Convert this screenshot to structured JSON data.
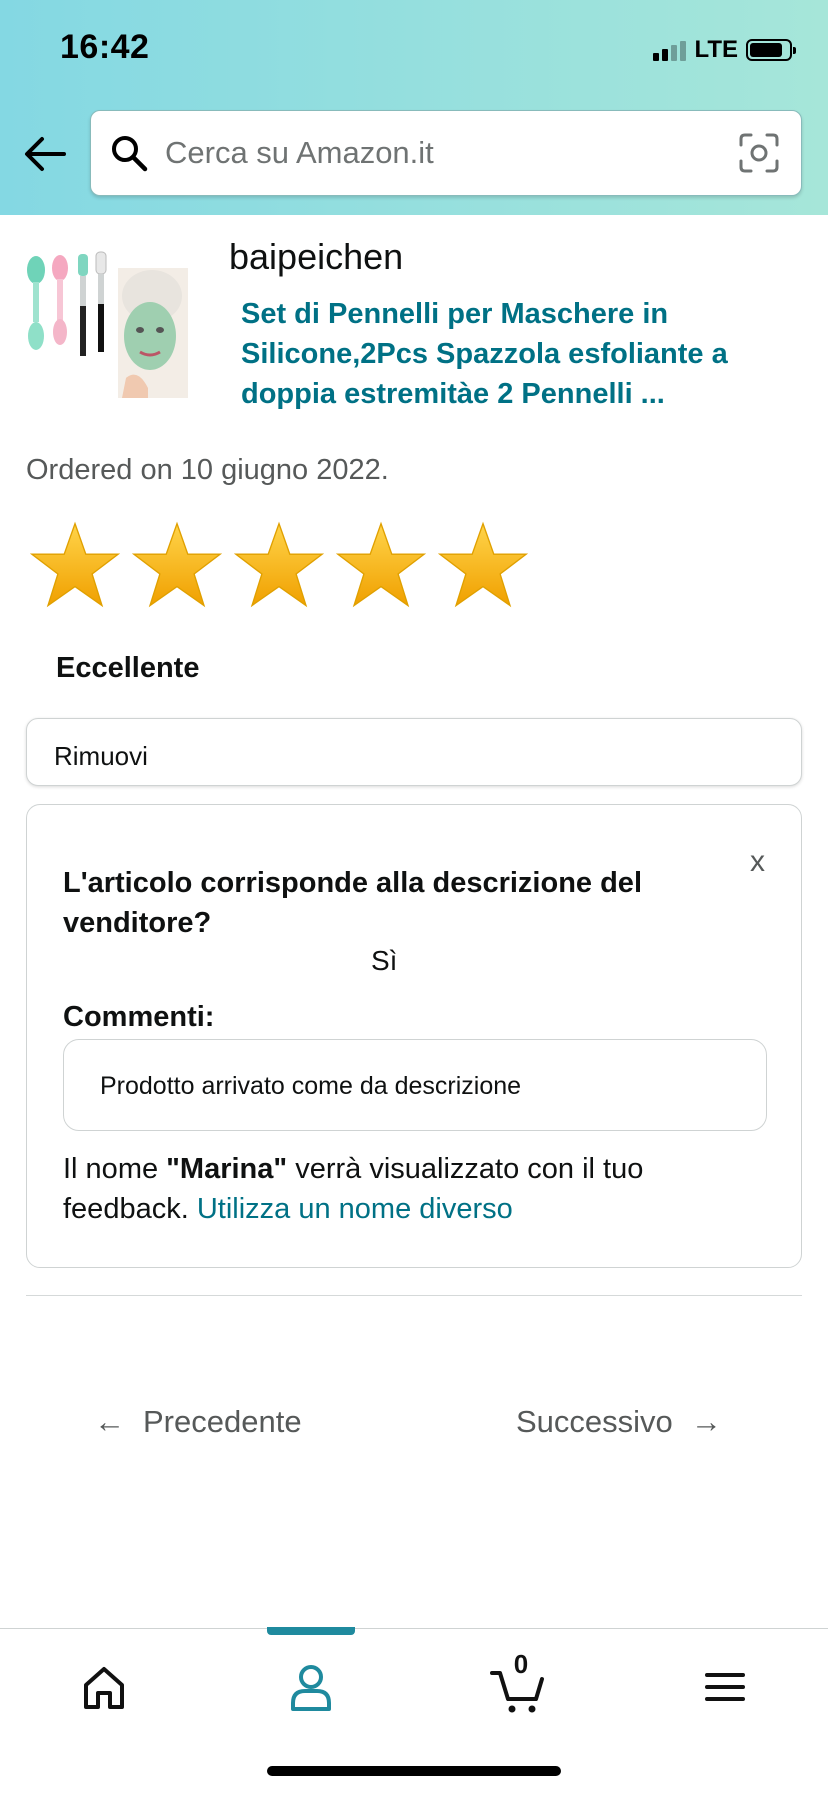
{
  "status_bar": {
    "time": "16:42",
    "network": "LTE"
  },
  "search": {
    "placeholder": "Cerca su Amazon.it"
  },
  "product": {
    "brand": "baipeichen",
    "title": "Set di Pennelli per Maschere in Silicone,2Pcs Spazzola esfoliante a doppia estremitàe 2 Pennelli ...",
    "ordered_text": "Ordered on 10 giugno 2022."
  },
  "rating": {
    "stars": 5,
    "max": 5,
    "label": "Eccellente"
  },
  "remove_label": "Rimuovi",
  "feedback": {
    "close_label": "x",
    "question": "L'articolo corrisponde alla descrizione del venditore?",
    "answer": "Sì",
    "comments_label": "Commenti:",
    "comment_value": "Prodotto arrivato come da descrizione",
    "name_prefix": "Il nome ",
    "name": "\"Marina\"",
    "name_suffix": " verrà visualizzato con il tuo feedback. ",
    "name_link": "Utilizza un nome diverso"
  },
  "pagination": {
    "prev_arrow": "←",
    "prev_label": "Precedente",
    "next_label": "Successivo",
    "next_arrow": "→"
  },
  "tabbar": {
    "cart_count": "0",
    "active_tab": "account",
    "accent_color": "#1f8a9e"
  },
  "colors": {
    "link": "#007185",
    "star": "#f5b100"
  }
}
